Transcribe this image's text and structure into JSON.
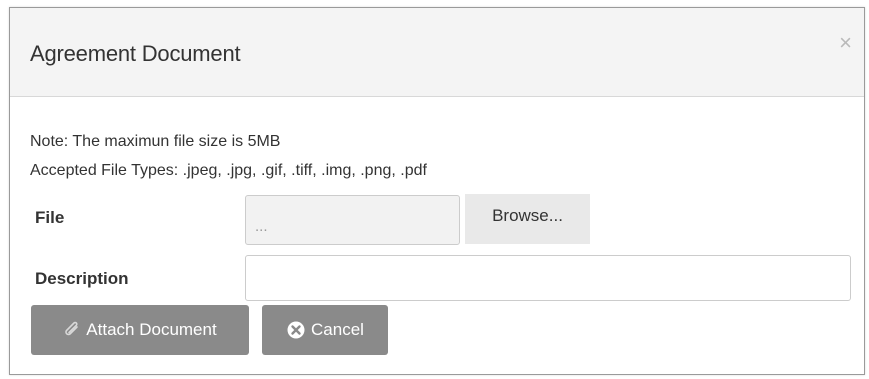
{
  "dialog": {
    "title": "Agreement Document",
    "close_symbol": "×"
  },
  "notes": {
    "max_size": "Note: The maximun file size is 5MB",
    "accepted_types": "Accepted File Types: .jpeg, .jpg, .gif, .tiff, .img, .png, .pdf"
  },
  "form": {
    "file_label": "File",
    "file_value": "...",
    "browse_label": "Browse...",
    "description_label": "Description",
    "description_value": ""
  },
  "actions": {
    "attach_label": "Attach Document",
    "attach_icon": "paperclip-icon",
    "cancel_label": "Cancel",
    "cancel_icon": "times-circle-icon"
  },
  "colors": {
    "header_bg": "#f4f4f4",
    "button_bg": "#8a8a8a",
    "browse_bg": "#e9e9e9"
  }
}
